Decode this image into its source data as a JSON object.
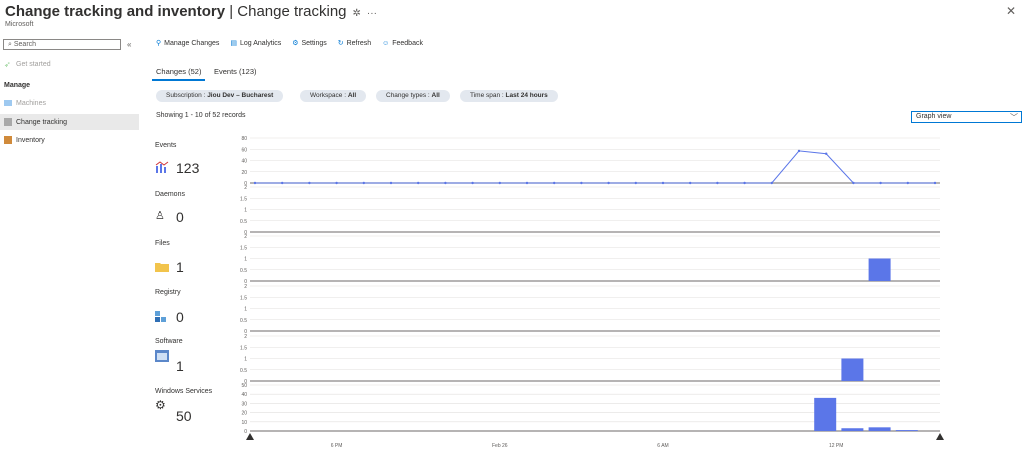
{
  "header": {
    "title_bold": "Change tracking and inventory",
    "title_rest": " | Change tracking",
    "pin_icon": "✲",
    "more_icon": "···",
    "subtitle": "Microsoft",
    "close_icon": "✕"
  },
  "sidebar": {
    "search_placeholder": "Search",
    "collapse_icon": "«",
    "items": [
      {
        "label": "Get started",
        "icon": "rocket-icon",
        "disabled": true
      },
      {
        "label": "Manage",
        "is_header": true
      },
      {
        "label": "Machines",
        "icon": "monitor-icon",
        "disabled": true
      },
      {
        "label": "Change tracking",
        "icon": "change-tracking-icon",
        "selected": true
      },
      {
        "label": "Inventory",
        "icon": "inventory-icon"
      }
    ]
  },
  "toolbar": {
    "manage_changes": "Manage Changes",
    "log_analytics": "Log Analytics",
    "settings": "Settings",
    "refresh": "Refresh",
    "feedback": "Feedback"
  },
  "tabs": [
    {
      "label": "Changes (52)",
      "selected": true
    },
    {
      "label": "Events (123)",
      "selected": false
    }
  ],
  "filters": [
    {
      "name": "Subscription : ",
      "value": "Jiou Dev – Bucharest"
    },
    {
      "name": "Workspace : ",
      "value": "All"
    },
    {
      "name": "Change types : ",
      "value": "All"
    },
    {
      "name": "Time span : ",
      "value": "Last 24 hours"
    }
  ],
  "records_text": "Showing 1 - 10 of 52 records",
  "view_select": "Graph view",
  "colors": {
    "accent": "#0078d4",
    "bar": "#5b76e8"
  },
  "chart_data": [
    {
      "type": "line",
      "title": "Events",
      "total": "123",
      "y_ticks": [
        "80",
        "60",
        "40",
        "20",
        "0"
      ],
      "ylim": [
        0,
        80
      ],
      "values": [
        0,
        0,
        0,
        0,
        0,
        0,
        0,
        0,
        0,
        0,
        0,
        0,
        0,
        0,
        0,
        0,
        0,
        0,
        0,
        0,
        57,
        52,
        0,
        0,
        0,
        0
      ]
    },
    {
      "type": "bar",
      "title": "Daemons",
      "total": "0",
      "y_ticks": [
        "2",
        "1.5",
        "1",
        "0.5",
        "0"
      ],
      "ylim": [
        0,
        2
      ],
      "bars": []
    },
    {
      "type": "bar",
      "title": "Files",
      "total": "1",
      "y_ticks": [
        "2",
        "1.5",
        "1",
        "0.5",
        "0"
      ],
      "ylim": [
        0,
        2
      ],
      "bars": [
        {
          "slot": 23,
          "value": 1
        }
      ]
    },
    {
      "type": "bar",
      "title": "Registry",
      "total": "0",
      "y_ticks": [
        "2",
        "1.5",
        "1",
        "0.5",
        "0"
      ],
      "ylim": [
        0,
        2
      ],
      "bars": []
    },
    {
      "type": "bar",
      "title": "Software",
      "total": "1",
      "y_ticks": [
        "2",
        "1.5",
        "1",
        "0.5",
        "0"
      ],
      "ylim": [
        0,
        2
      ],
      "bars": [
        {
          "slot": 22,
          "value": 1
        }
      ]
    },
    {
      "type": "bar",
      "title": "Windows Services",
      "total": "50",
      "y_ticks": [
        "50",
        "40",
        "30",
        "20",
        "10",
        "0"
      ],
      "ylim": [
        0,
        50
      ],
      "bars": [
        {
          "slot": 21,
          "value": 36
        },
        {
          "slot": 22,
          "value": 3
        },
        {
          "slot": 23,
          "value": 4
        },
        {
          "slot": 24,
          "value": 1
        }
      ]
    }
  ],
  "x_axis": {
    "labels": [
      {
        "slot": 3,
        "text": "6 PM"
      },
      {
        "slot": 9,
        "text": "Feb 26"
      },
      {
        "slot": 15,
        "text": "6 AM"
      },
      {
        "slot": 21,
        "text": "12 PM"
      }
    ]
  }
}
